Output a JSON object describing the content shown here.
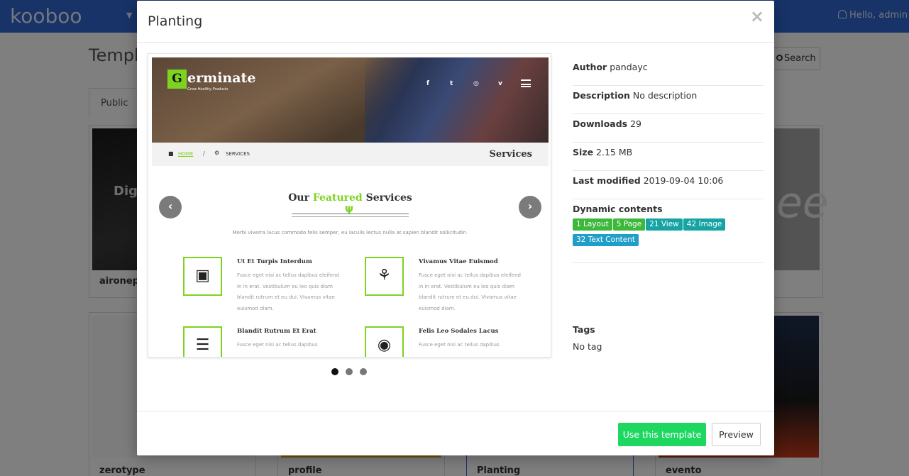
{
  "app": {
    "logo": "kooboo",
    "greeting": "Hello, admin",
    "page_title": "Templa",
    "search_label": "Search",
    "tab_public": "Public",
    "cards": [
      {
        "name": "aironepa",
        "thumb_text": "Digit"
      },
      {
        "name": "",
        "thumb_text": "ee"
      },
      {
        "name": "zerotype"
      },
      {
        "name": "profile"
      },
      {
        "name": "Planting"
      },
      {
        "name": "evento"
      }
    ]
  },
  "modal": {
    "title": "Planting",
    "close_glyph": "×",
    "carousel": {
      "prev_glyph": "‹",
      "next_glyph": "›",
      "dots": 3,
      "active_dot": 0,
      "slide": {
        "logo_letter": "G",
        "logo_text": "erminate",
        "logo_tagline": "Grow Healthy Products",
        "social": [
          "f",
          "t",
          "◎",
          "v"
        ],
        "crumb_home": "HOME",
        "crumb_sep": "/",
        "crumb_current": "SERVICES",
        "crumb_title": "Services",
        "heading_a": "Our ",
        "heading_accent": "Featured",
        "heading_b": " Services",
        "description": "Morbi viverra lacus commodo felis semper, eu iaculis lectus nulla at sapien blandit sollicitudin.",
        "services": [
          {
            "title": "Ut Et Turpis Interdum",
            "text": "Fusce eget nisi ac tellus dapibus eleifend in in erat. Vestibulum eu leo quis diam blandit rutrum et eu dui. Vivamus vitae euismod diam.",
            "icon": "cart-icon"
          },
          {
            "title": "Vivamus Vitae Euismod",
            "text": "Fusce eget nisi ac tellus dapibus eleifend in in erat. Vestibulum eu leo quis diam blandit rutrum et eu dui. Vivamus vitae euismod diam.",
            "icon": "wheelbarrow-icon"
          },
          {
            "title": "Blandit Rutrum Et Erat",
            "text": "Fusce eget nisi ac tellus dapibus",
            "icon": "tools-icon"
          },
          {
            "title": "Felis Leo Sodales Lacus",
            "text": "Fusce eget nisi ac tellus dapibus",
            "icon": "basket-icon"
          }
        ]
      }
    },
    "details": {
      "author_label": "Author",
      "author": "pandayc",
      "description_label": "Description",
      "description": "No description",
      "downloads_label": "Downloads",
      "downloads": "29",
      "size_label": "Size",
      "size": "2.15 MB",
      "modified_label": "Last modified",
      "modified": "2019-09-04 10:06",
      "dynamic_label": "Dynamic contents",
      "dynamic": [
        {
          "label": "1 Layout",
          "color": "#3cb83c"
        },
        {
          "label": "5 Page",
          "color": "#3cb83c"
        },
        {
          "label": "21 View",
          "color": "#16a3a3"
        },
        {
          "label": "42 Image",
          "color": "#16a3a3"
        },
        {
          "label": "32 Text Content",
          "color": "#1e9ec9"
        }
      ],
      "tags_label": "Tags",
      "tags": "No tag"
    },
    "footer": {
      "use_label": "Use this template",
      "preview_label": "Preview"
    }
  },
  "colors": {
    "topbar": "#2f66cf",
    "accent_green": "#7ed321",
    "use_button": "#1ed760"
  }
}
